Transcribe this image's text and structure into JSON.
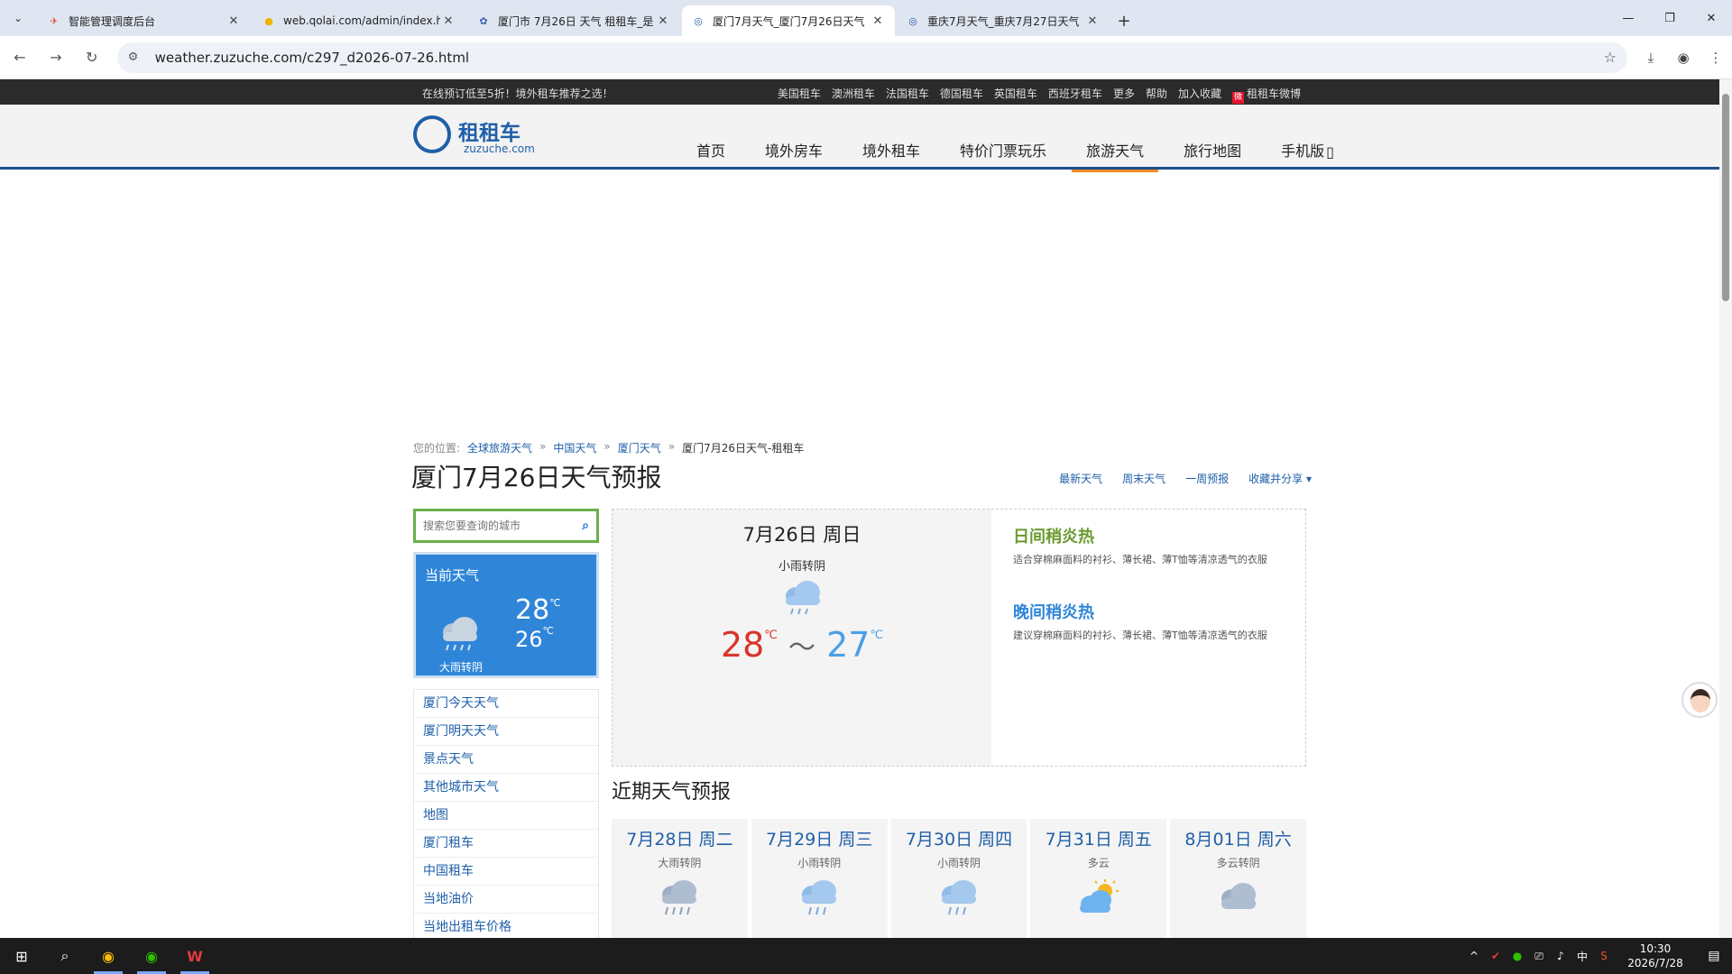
{
  "browser": {
    "tabs": [
      {
        "title": "智能管理调度后台",
        "active": false
      },
      {
        "title": "web.qolai.com/admin/index.h",
        "active": false
      },
      {
        "title": "厦门市 7月26日 天气 租租车_是",
        "active": false
      },
      {
        "title": "厦门7月天气_厦门7月26日天气",
        "active": true
      },
      {
        "title": "重庆7月天气_重庆7月27日天气",
        "active": false
      }
    ],
    "url": "weather.zuzuche.com/c297_d2026-07-26.html"
  },
  "topstrip": {
    "promo": "在线预订低至5折！境外租车推荐之选！",
    "links": [
      "美国租车",
      "澳洲租车",
      "法国租车",
      "德国租车",
      "英国租车",
      "西班牙租车",
      "更多",
      "帮助",
      "加入收藏"
    ],
    "weibo": "租租车微博"
  },
  "logo": {
    "name": "租租车",
    "domain": "zuzuche.com"
  },
  "nav": [
    {
      "label": "首页",
      "active": false
    },
    {
      "label": "境外房车",
      "active": false
    },
    {
      "label": "境外租车",
      "active": false
    },
    {
      "label": "特价门票玩乐",
      "active": false
    },
    {
      "label": "旅游天气",
      "active": true
    },
    {
      "label": "旅行地图",
      "active": false
    },
    {
      "label": "手机版",
      "active": false
    }
  ],
  "breadcrumb": {
    "prefix": "您的位置:",
    "links": [
      "全球旅游天气",
      "中国天气",
      "厦门天气"
    ],
    "current": "厦门7月26日天气-租租车"
  },
  "page_title": "厦门7月26日天气预报",
  "title_links": [
    "最新天气",
    "周末天气",
    "一周预报",
    "收藏并分享 ▾"
  ],
  "search": {
    "placeholder": "搜索您要查询的城市"
  },
  "current_weather": {
    "label": "当前天气",
    "high": "28",
    "low": "26",
    "unit": "℃",
    "condition": "大雨转阴"
  },
  "side_links": [
    "厦门今天天气",
    "厦门明天天气",
    "景点天气",
    "其他城市天气",
    "地图",
    "厦门租车",
    "中国租车",
    "当地油价",
    "当地出租车价格"
  ],
  "day": {
    "date": "7月26日 周日",
    "condition": "小雨转阴",
    "high": "28",
    "low": "27",
    "unit": "℃",
    "tilde": "～"
  },
  "tips": {
    "day_title": "日间稍炎热",
    "day_text": "适合穿棉麻面料的衬衫、薄长裙、薄T恤等清凉透气的衣服",
    "night_title": "晚间稍炎热",
    "night_text": "建议穿棉麻面料的衬衫、薄长裙、薄T恤等清凉透气的衣服"
  },
  "forecast_title": "近期天气预报",
  "forecast": [
    {
      "date": "7月28日 周二",
      "condition": "大雨转阴",
      "icon": "rain-cloud-icon"
    },
    {
      "date": "7月29日 周三",
      "condition": "小雨转阴",
      "icon": "rain-cloud-icon"
    },
    {
      "date": "7月30日 周四",
      "condition": "小雨转阴",
      "icon": "rain-cloud-icon"
    },
    {
      "date": "7月31日 周五",
      "condition": "多云",
      "icon": "sun-cloud-icon"
    },
    {
      "date": "8月01日 周六",
      "condition": "多云转阴",
      "icon": "cloud-icon"
    }
  ],
  "taskbar": {
    "time": "10:30",
    "date": "2026/7/28",
    "ime": "中"
  },
  "colors": {
    "brand_blue": "#1f5fa8",
    "nav_active": "#f08a24",
    "current_weather_bg": "#2f86d9",
    "temp_high": "#d9342b",
    "temp_low": "#4aa0e6",
    "search_border": "#6ab04c"
  }
}
